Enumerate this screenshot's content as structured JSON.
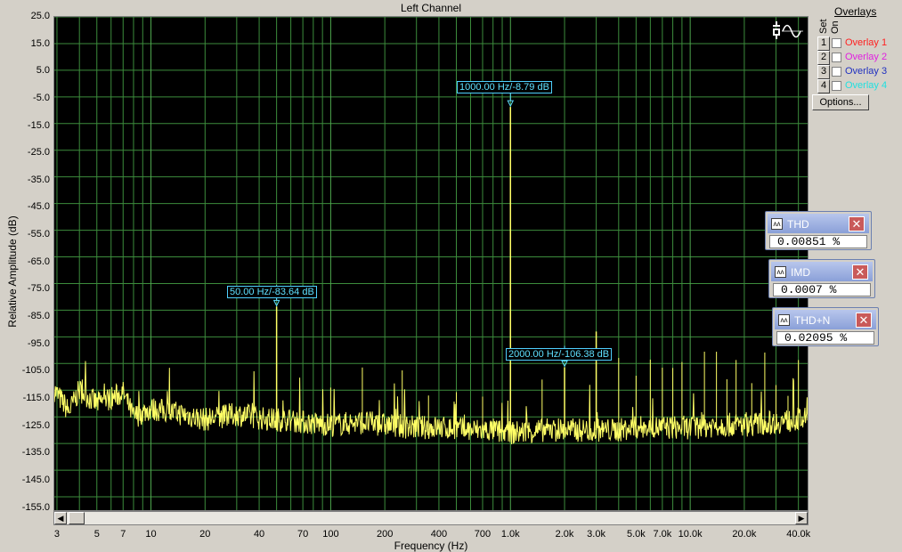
{
  "window": {
    "title": "Left Channel"
  },
  "axes": {
    "ylabel": "Relative Amplitude (dB)",
    "xlabel": "Frequency (Hz)",
    "yticks": [
      "25.0",
      "15.0",
      "5.0",
      "-5.0",
      "-15.0",
      "-25.0",
      "-35.0",
      "-45.0",
      "-55.0",
      "-65.0",
      "-75.0",
      "-85.0",
      "-95.0",
      "-105.0",
      "-115.0",
      "-125.0",
      "-135.0",
      "-145.0",
      "-155.0"
    ],
    "xticks": [
      "3",
      "5",
      "7",
      "10",
      "20",
      "40",
      "70",
      "100",
      "200",
      "400",
      "700",
      "1.0k",
      "2.0k",
      "3.0k",
      "5.0k",
      "7.0k",
      "10.0k",
      "20.0k",
      "40.0k"
    ]
  },
  "markers": [
    {
      "label": "1000.00 Hz/-8.79 dB"
    },
    {
      "label": "50.00 Hz/-83.64 dB"
    },
    {
      "label": "2000.00 Hz/-106.38 dB"
    }
  ],
  "overlays": {
    "title": "Overlays",
    "set_label": "Set",
    "on_label": "On",
    "items": [
      {
        "num": "1",
        "name": "Overlay 1",
        "color": "#ff2020"
      },
      {
        "num": "2",
        "name": "Overlay 2",
        "color": "#e020e0"
      },
      {
        "num": "3",
        "name": "Overlay 3",
        "color": "#2030c0"
      },
      {
        "num": "4",
        "name": "Overlay 4",
        "color": "#20e0e0"
      }
    ],
    "options_label": "Options..."
  },
  "meters": {
    "thd": {
      "label": "THD",
      "value": "0.00851 %"
    },
    "imd": {
      "label": "IMD",
      "value": "0.0007 %"
    },
    "thdn": {
      "label": "THD+N",
      "value": "0.02095 %"
    }
  },
  "chart_data": {
    "type": "line",
    "title": "Left Channel",
    "xlabel": "Frequency (Hz)",
    "ylabel": "Relative Amplitude (dB)",
    "xscale": "log",
    "xlim": [
      2.9,
      45000
    ],
    "ylim": [
      -160,
      25
    ],
    "grid": true,
    "series": [
      {
        "color": "#ffff66",
        "x": [
          2.9,
          3.5,
          4,
          5,
          6,
          7,
          8,
          10,
          15,
          20,
          30,
          45,
          50,
          55,
          70,
          100,
          150,
          200,
          300,
          400,
          600,
          800,
          950,
          1000,
          1050,
          1500,
          2000,
          2500,
          3000,
          3500,
          4000,
          5000,
          7000,
          10000,
          15000,
          20000,
          30000,
          40000,
          45000
        ],
        "y": [
          -115,
          -123,
          -115,
          -120,
          -118,
          -116,
          -125,
          -122,
          -124,
          -126,
          -124,
          -126,
          -83.6,
          -126,
          -127,
          -128,
          -127,
          -128,
          -129,
          -129,
          -130,
          -130,
          -131,
          -8.79,
          -131,
          -130,
          -106.4,
          -130,
          -93,
          -130,
          -130,
          -129,
          -129,
          -129,
          -128,
          -128,
          -127,
          -126,
          -126
        ]
      }
    ]
  }
}
